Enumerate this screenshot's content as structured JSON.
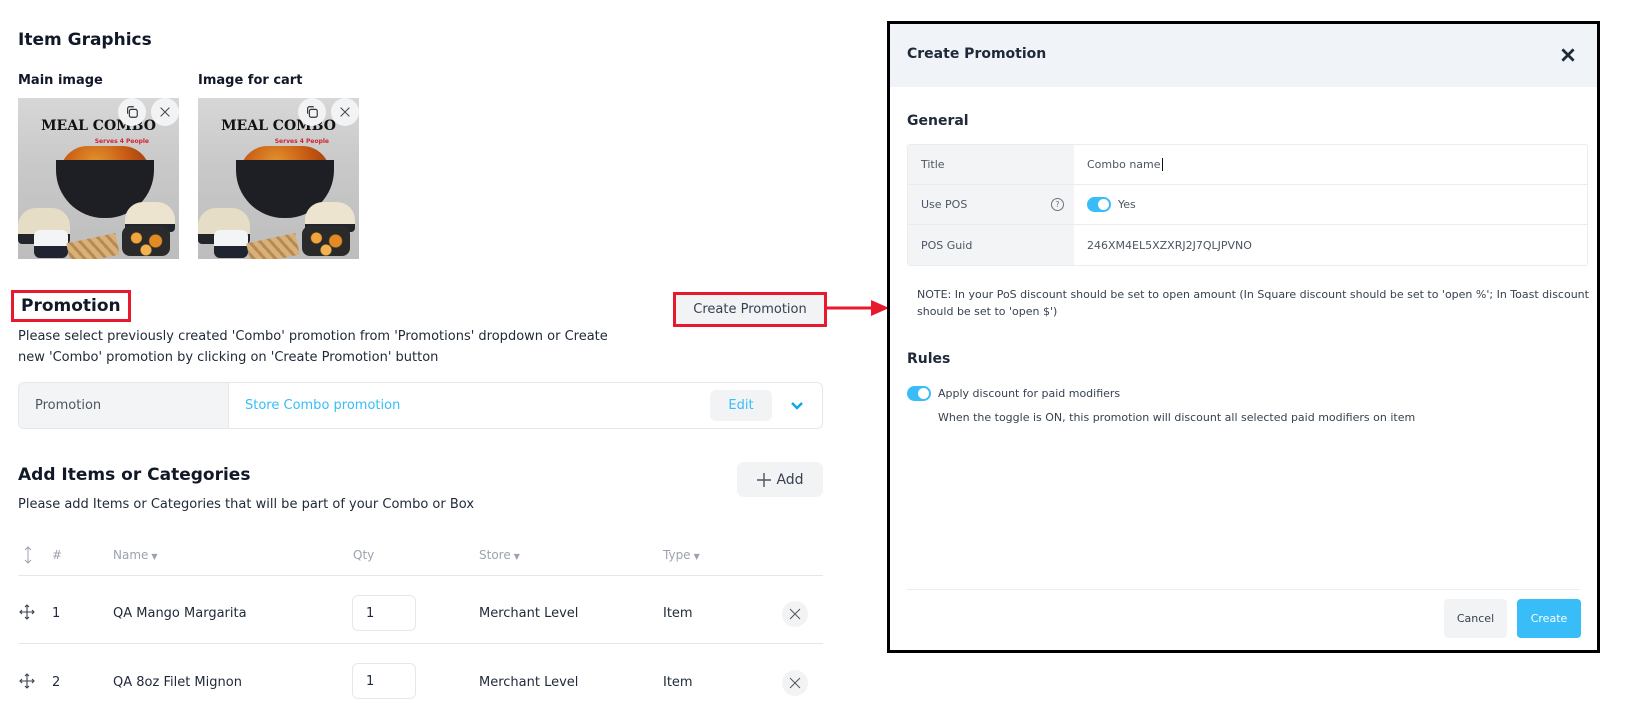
{
  "item_graphics": {
    "title": "Item Graphics",
    "main_image_label": "Main image",
    "cart_image_label": "Image for cart",
    "image_text": "MEAL COMBO",
    "image_subtext": "Serves 4 People"
  },
  "promotion": {
    "title": "Promotion",
    "description": "Please select previously created 'Combo' promotion from 'Promotions' dropdown or Create new 'Combo' promotion by clicking on 'Create Promotion' button",
    "create_button": "Create Promotion",
    "field_label": "Promotion",
    "field_value": "Store Combo promotion",
    "edit_button": "Edit"
  },
  "items": {
    "title": "Add Items or Categories",
    "description": "Please add Items or Categories that will be part of your Combo or Box",
    "add_button": "Add",
    "columns": {
      "index": "#",
      "name": "Name",
      "qty": "Qty",
      "store": "Store",
      "type": "Type"
    },
    "rows": [
      {
        "index": "1",
        "name": "QA Mango Margarita",
        "qty": "1",
        "store": "Merchant Level",
        "type": "Item"
      },
      {
        "index": "2",
        "name": "QA 8oz Filet Mignon",
        "qty": "1",
        "store": "Merchant Level",
        "type": "Item"
      }
    ]
  },
  "modal": {
    "title": "Create Promotion",
    "general_title": "General",
    "fields": {
      "title_label": "Title",
      "title_value": "Combo name",
      "use_pos_label": "Use POS",
      "use_pos_value": "Yes",
      "use_pos_on": true,
      "pos_guid_label": "POS Guid",
      "pos_guid_value": "246XM4EL5XZXRJ2J7QLJPVNO"
    },
    "note": "NOTE: In your PoS discount should be set to open amount (In Square discount should be set to 'open %'; In Toast discount should be set to 'open $')",
    "rules_title": "Rules",
    "rule_label": "Apply discount for paid modifiers",
    "rule_on": true,
    "rule_description": "When the toggle is ON, this promotion will discount all selected paid modifiers on item",
    "cancel_button": "Cancel",
    "create_button": "Create"
  },
  "colors": {
    "accent": "#38bdf8",
    "highlight": "#e8192c"
  }
}
